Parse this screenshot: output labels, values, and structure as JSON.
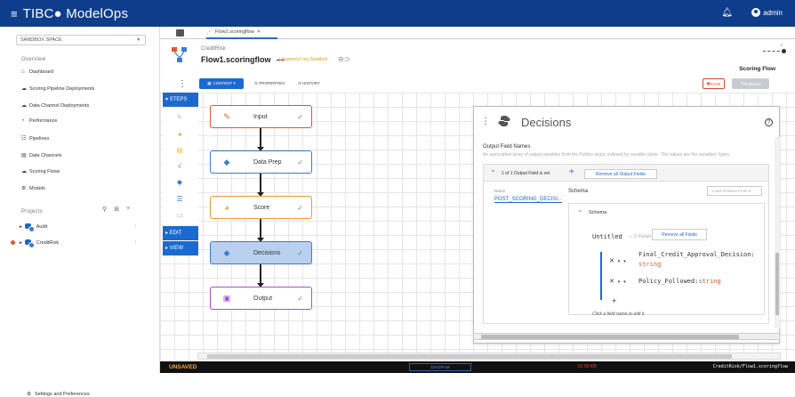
{
  "header": {
    "brand": "TIBC● ModelOps",
    "user": "admin"
  },
  "sidebar": {
    "space": "SANDBOX SPACE",
    "overview_heading": "Overview",
    "items": [
      {
        "label": "Dashboard",
        "icon": "home-icon"
      },
      {
        "label": "Scoring Pipeline Deployments",
        "icon": "cloud-icon"
      },
      {
        "label": "Data Channel Deployments",
        "icon": "cloud-icon"
      },
      {
        "label": "Performance",
        "icon": "gauge-icon"
      },
      {
        "label": "Pipelines",
        "icon": "pipeline-icon"
      },
      {
        "label": "Data Channels",
        "icon": "database-icon"
      },
      {
        "label": "Scoring Flows",
        "icon": "flow-icon"
      },
      {
        "label": "Models",
        "icon": "model-icon"
      }
    ],
    "projects_heading": "Projects",
    "projects": [
      {
        "label": "Audit"
      },
      {
        "label": "CreditRisk"
      }
    ],
    "settings": "Settings and Preferences"
  },
  "tab": {
    "label": "Flow1.scoringflow"
  },
  "flow": {
    "project": "CreditRisk",
    "name": "Flow1.scoringflow",
    "dash": "—",
    "unsaved_note": "Unsaved in my Sandbox",
    "type_label": "Scoring Flow",
    "version": "1"
  },
  "toolbar": {
    "content": "CONTENT ▾",
    "properties": "PROPERTIES",
    "history": "HISTORY",
    "save": "SAVE",
    "publish": "PUBLISH"
  },
  "palette": {
    "steps": "▾ STEPS",
    "edit": "▸ EDIT",
    "view": "▸ VIEW"
  },
  "nodes": [
    {
      "label": "Input",
      "color": "#e2572b"
    },
    {
      "label": "Data Prep",
      "color": "#3a7bd5"
    },
    {
      "label": "Score",
      "color": "#f29a2e"
    },
    {
      "label": "Decisions",
      "color": "#3a7bd5"
    },
    {
      "label": "Output",
      "color": "#a84fd1"
    }
  ],
  "panel": {
    "title": "Decisions",
    "section": "Output Field Names",
    "description": "An associative array of output variables from the Python script, indexed by variable name. The values are the variables' types.",
    "count": "1 of 1 Output Field is set",
    "remove_all": "Remove all Output Fields",
    "name_label": "Name",
    "name_value": "POST_SCORING_DECISI...",
    "schema_label": "Schema",
    "load_schema": "Load Schema From ▾",
    "schema_title": "Schema",
    "untitled": "Untitled",
    "field_count": "— 2 Fields",
    "remove_fields": "Remove all Fields",
    "fields": [
      {
        "name": "Final_Credit_Approval_Decision:",
        "type": "string"
      },
      {
        "name": "Policy_Followed:",
        "type": "string"
      }
    ],
    "hint": "Click a field name to edit it"
  },
  "status": {
    "unsaved": "UNSAVED",
    "middle": "DIAGRAM",
    "memory": "61.69 KB",
    "path": "CreditRisk/Flow1.scoringflow"
  }
}
